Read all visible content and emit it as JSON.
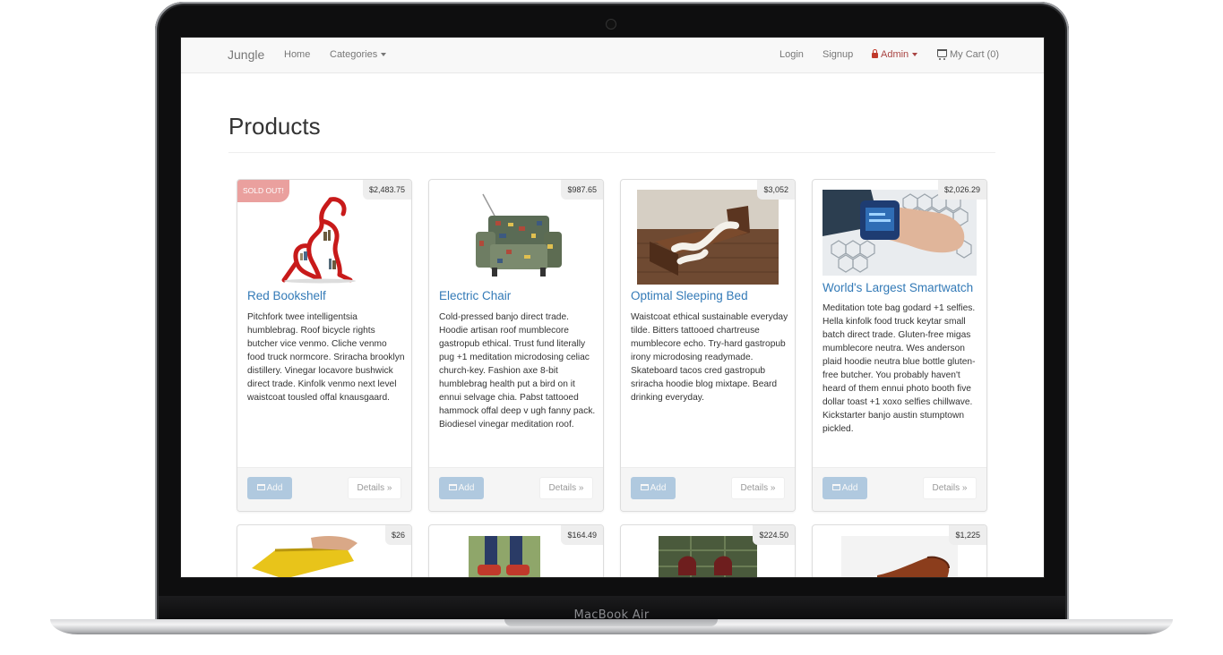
{
  "device": {
    "label": "MacBook Air"
  },
  "navbar": {
    "brand": "Jungle",
    "home": "Home",
    "categories": "Categories",
    "login": "Login",
    "signup": "Signup",
    "admin": "Admin",
    "cart": "My Cart (0)"
  },
  "page": {
    "title": "Products"
  },
  "buttons": {
    "add": "Add",
    "details": "Details »"
  },
  "products": [
    {
      "name": "Red Bookshelf",
      "price": "$2,483.75",
      "badge": "SOLD OUT!",
      "description": "Pitchfork twee intelligentsia humblebrag. Roof bicycle rights butcher vice venmo. Cliche venmo food truck normcore. Sriracha brooklyn distillery. Vinegar locavore bushwick direct trade. Kinfolk venmo next level waistcoat tousled offal knausgaard."
    },
    {
      "name": "Electric Chair",
      "price": "$987.65",
      "description": "Cold-pressed banjo direct trade. Hoodie artisan roof mumblecore gastropub ethical. Trust fund literally pug +1 meditation microdosing celiac church-key. Fashion axe 8-bit humblebrag health put a bird on it ennui selvage chia. Pabst tattooed hammock offal deep v ugh fanny pack. Biodiesel vinegar meditation roof."
    },
    {
      "name": "Optimal Sleeping Bed",
      "price": "$3,052",
      "description": "Waistcoat ethical sustainable everyday tilde. Bitters tattooed chartreuse mumblecore echo. Try-hard gastropub irony microdosing readymade. Skateboard tacos cred gastropub sriracha hoodie blog mixtape. Beard drinking everyday."
    },
    {
      "name": "World's Largest Smartwatch",
      "price": "$2,026.29",
      "description": "Meditation tote bag godard +1 selfies. Hella kinfolk food truck keytar small batch direct trade. Gluten-free migas mumblecore neutra. Wes anderson plaid hoodie neutra blue bottle gluten-free butcher. You probably haven't heard of them ennui photo booth five dollar toast +1 xoxo selfies chillwave. Kickstarter banjo austin stumptown pickled."
    },
    {
      "price": "$26"
    },
    {
      "price": "$164.49"
    },
    {
      "price": "$224.50"
    },
    {
      "price": "$1,225"
    }
  ]
}
